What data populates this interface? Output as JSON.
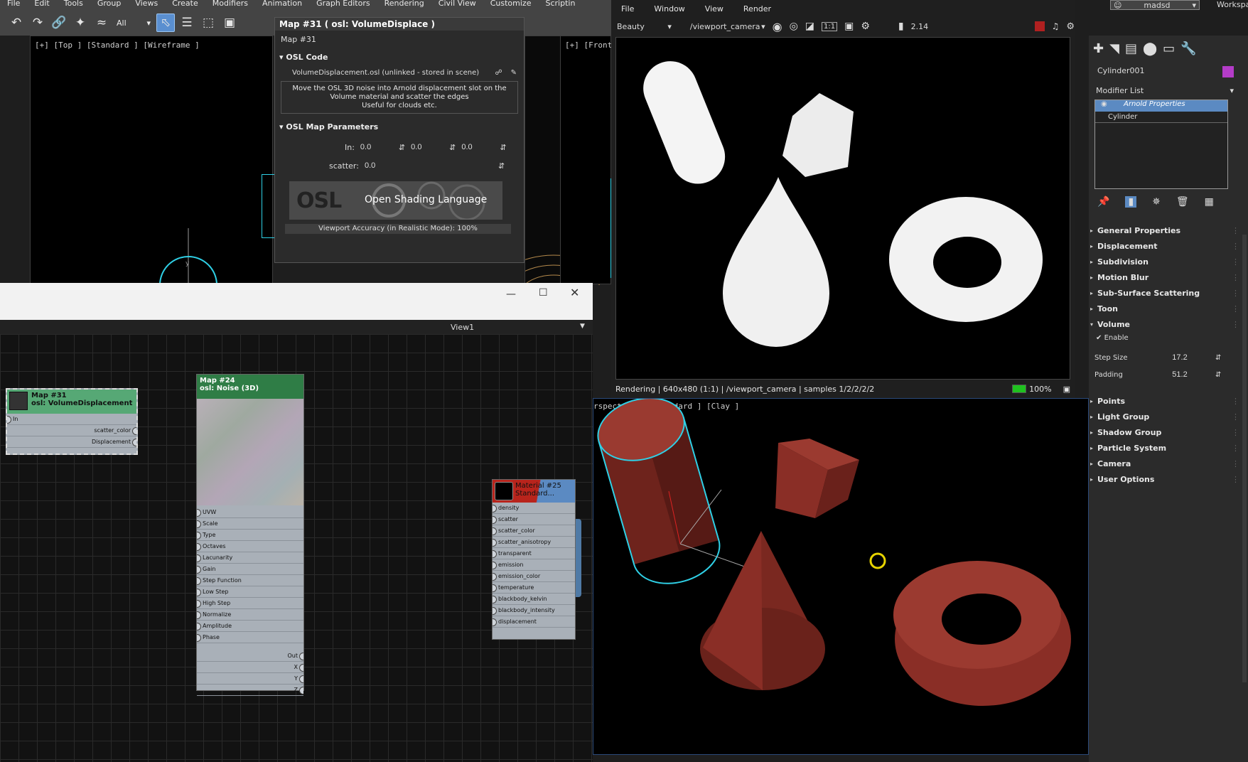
{
  "menu": [
    "File",
    "Edit",
    "Tools",
    "Group",
    "Views",
    "Create",
    "Modifiers",
    "Animation",
    "Graph Editors",
    "Rendering",
    "Civil View",
    "Customize",
    "Scriptin"
  ],
  "user": {
    "name": "madsd",
    "workspace_label": "Workspa"
  },
  "toolbar": {
    "selection_filter": "All"
  },
  "viewports": {
    "top_label": "[+] [Top ] [Standard ] [Wireframe ]",
    "front_label": "[+] [Front ] [",
    "persp_label": "rspective ] [Standard ] [Clay ]"
  },
  "osl_panel": {
    "title": "Map #31  ( osl: VolumeDisplace )",
    "map_name": "Map #31",
    "code_rollout": "OSL Code",
    "file_label": "VolumeDisplacement.osl (unlinked - stored in scene)",
    "description": "Move the OSL 3D noise into Arnold displacement slot on the Volume material and scatter the edges\nUseful for clouds etc.",
    "params_rollout": "OSL Map Parameters",
    "in_label": "In:",
    "in_values": [
      "0.0",
      "0.0",
      "0.0"
    ],
    "scatter_label": "scatter:",
    "scatter_value": "0.0",
    "banner_text": "Open Shading Language",
    "banner_logo": "OSL",
    "accuracy": "Viewport Accuracy (in Realistic Mode): 100%"
  },
  "node_editor": {
    "view_name": "View1",
    "nodes": {
      "map31": {
        "title1": "Map #31",
        "title2": "osl: VolumeDisplacement",
        "inputs": [
          "In"
        ],
        "outputs": [
          "scatter_color",
          "Displacement"
        ]
      },
      "map24": {
        "title1": "Map #24",
        "title2": "osl: Noise (3D)",
        "inputs": [
          "UVW",
          "Scale",
          "Type",
          "Octaves",
          "Lacunarity",
          "Gain",
          "Step Function",
          "Low Step",
          "High Step",
          "Normalize",
          "Amplitude",
          "Phase"
        ],
        "outputs": [
          "Out",
          "X",
          "Y",
          "Z"
        ]
      },
      "mat25": {
        "title1": "Material #25",
        "title2": "Standard...",
        "inputs": [
          "density",
          "scatter",
          "scatter_color",
          "scatter_anisotropy",
          "transparent",
          "emission",
          "emission_color",
          "temperature",
          "blackbody_kelvin",
          "blackbody_intensity",
          "displacement"
        ]
      }
    }
  },
  "render_window": {
    "menu": [
      "File",
      "Window",
      "View",
      "Render"
    ],
    "channel": "Beauty",
    "camera": "/viewport_camera",
    "ratio_label": "1:1",
    "exposure": "2.14",
    "status": "Rendering | 640x480 (1:1) | /viewport_camera | samples 1/2/2/2/2",
    "progress_label": "100%",
    "progress_fraction": 1.0
  },
  "command_panel": {
    "object_name": "Cylinder001",
    "object_color": "#b43cc8",
    "modifier_list_label": "Modifier List",
    "stack": [
      "Arnold Properties",
      "Cylinder"
    ],
    "rollouts": [
      "General Properties",
      "Displacement",
      "Subdivision",
      "Motion Blur",
      "Sub-Surface Scattering",
      "Toon"
    ],
    "volume_rollout": "Volume",
    "enable_label": "Enable",
    "step_size_label": "Step Size",
    "step_size_value": "17.2",
    "padding_label": "Padding",
    "padding_value": "51.2",
    "rollouts2": [
      "Points",
      "Light Group",
      "Shadow Group",
      "Particle System",
      "Camera",
      "User Options"
    ]
  },
  "colors": {
    "accent": "#5a8fd0",
    "selection_cyan": "#2fd0e6",
    "clay": "#7a2b24",
    "node_green": "#3f8f5a"
  }
}
